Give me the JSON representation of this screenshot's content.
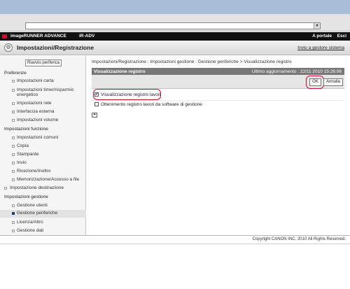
{
  "browser": {
    "dropdown_glyph": "▼"
  },
  "appbar": {
    "product": "imageRUNNER ADVANCE",
    "model": "iR-ADV",
    "to_portal": "A portale",
    "exit": "Esci"
  },
  "titlebar": {
    "title": "Impostazioni/Registrazione",
    "send_link": "Invio a gestore sistema",
    "icon": "settings-icon"
  },
  "sidebar": {
    "restart_button": "Riavvio periferica",
    "sections": [
      {
        "heading": "Preferenze"
      },
      {
        "heading": "Impostazioni funzione"
      },
      {
        "heading": "Impostazioni gestione"
      }
    ],
    "items": [
      {
        "label": "Impostazioni carta"
      },
      {
        "label": "Impostazioni timer/risparmio"
      },
      {
        "label": "energetico"
      },
      {
        "label": "Impostazioni rete"
      },
      {
        "label": "Interfaccia esterna"
      },
      {
        "label": "Impostazioni volume"
      },
      {
        "label": "Impostazioni comuni"
      },
      {
        "label": "Copia"
      },
      {
        "label": "Stampante"
      },
      {
        "label": "Invio"
      },
      {
        "label": "Ricezione/Inoltro"
      },
      {
        "label": "Memorizzazione/Accesso a file"
      },
      {
        "label": "Impostazione destinazione"
      },
      {
        "label": "Gestione utenti"
      },
      {
        "label": "Gestione periferiche"
      },
      {
        "label": "Licenza/Altro"
      },
      {
        "label": "Gestione dati"
      }
    ]
  },
  "main": {
    "breadcrumb": "Impostazioni/Registrazione : Impostazioni gestione : Gestione periferiche > Visualizzazione registro",
    "panel_title": "Visualizzazione registro",
    "last_updated": "Ultimo aggiornamento : 22/11 2010 15:26:06",
    "ok_button": "OK",
    "cancel_button": "Annulla",
    "options": [
      {
        "label": "Visualizzazione registro lavori",
        "checked": true
      },
      {
        "label": "Ottenimento registro lavori da software di gestione",
        "checked": false
      }
    ],
    "top_icon": "⏶"
  },
  "footer": {
    "copyright": "Copyright CANON INC. 2010 All Rights Reserved."
  },
  "colors": {
    "highlight": "#c8102e",
    "appbar": "#111111",
    "panel_header": "#777777",
    "browser_top": "#a9bcd8"
  }
}
